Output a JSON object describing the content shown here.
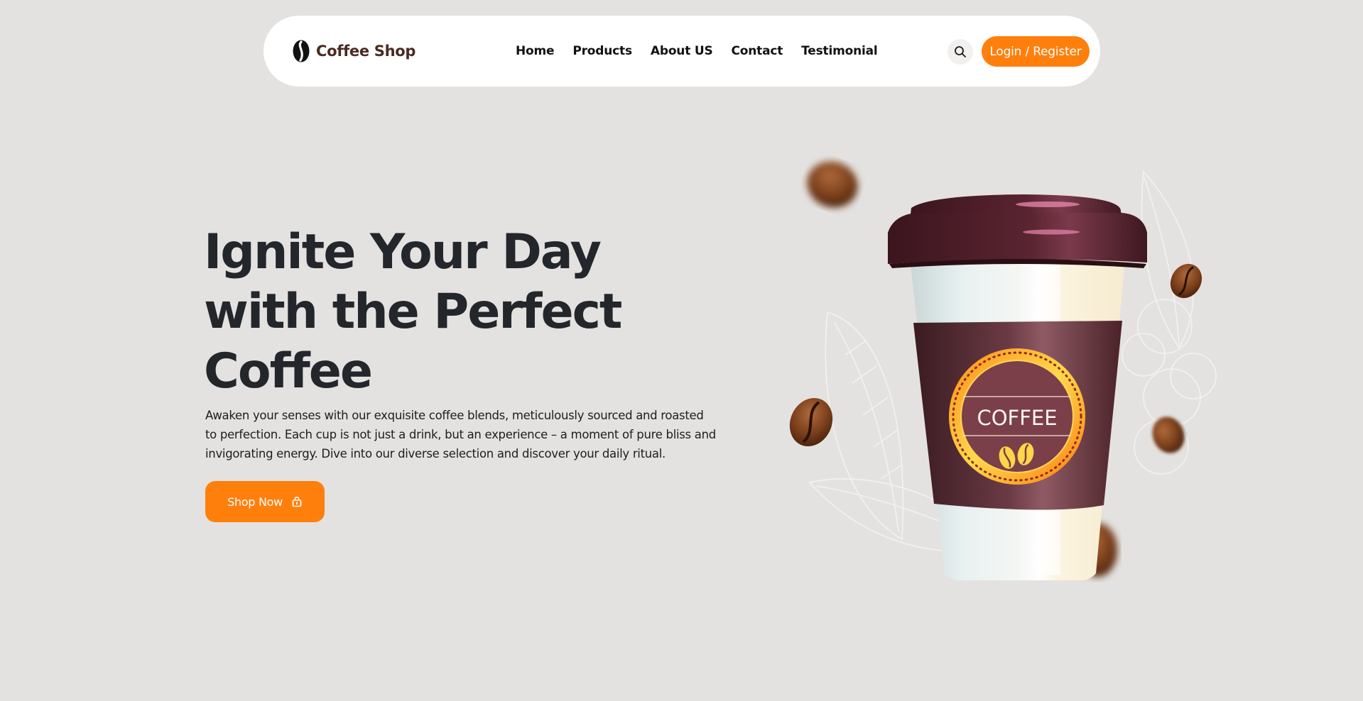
{
  "brand": {
    "name": "Coffee Shop"
  },
  "nav": {
    "links": [
      "Home",
      "Products",
      "About US",
      "Contact",
      "Testimonial"
    ]
  },
  "header": {
    "login_label": "Login / Register"
  },
  "hero": {
    "title_lines": [
      "Ignite Your Day",
      "with the Perfect",
      "Coffee"
    ],
    "description": "Awaken your senses with our exquisite coffee blends, meticulously sourced and roasted to perfection. Each cup is not just a drink, but an experience – a moment of pure bliss and invigorating energy. Dive into our diverse selection and discover your daily ritual.",
    "cta_label": "Shop Now"
  },
  "illustration": {
    "cup_label": "COFFEE"
  },
  "colors": {
    "accent": "#ff7f0d",
    "background": "#e4e2e0",
    "brand_text": "#4a2b22",
    "heading": "#23262b",
    "cup_lid": "#4a2028",
    "cup_sleeve": "#5a2d36"
  },
  "icons": {
    "brand": "coffee-bean-logo-icon",
    "search": "search-icon",
    "cta": "shopping-bag-icon"
  }
}
